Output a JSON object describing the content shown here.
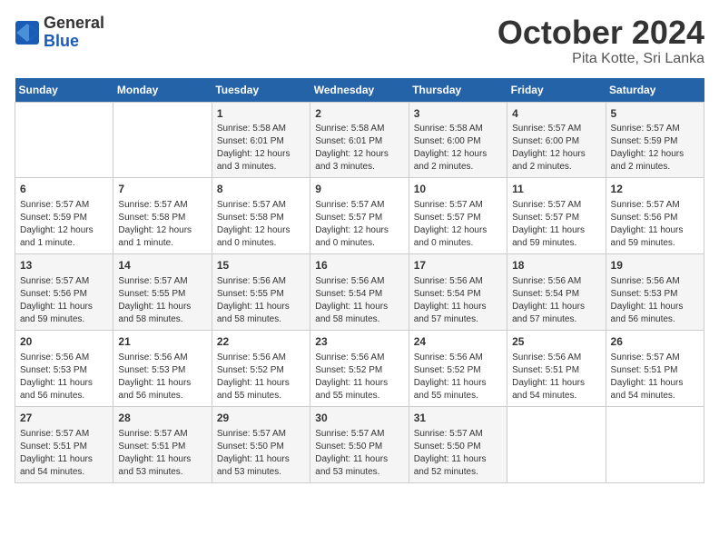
{
  "header": {
    "logo_general": "General",
    "logo_blue": "Blue",
    "month_title": "October 2024",
    "location": "Pita Kotte, Sri Lanka"
  },
  "days_of_week": [
    "Sunday",
    "Monday",
    "Tuesday",
    "Wednesday",
    "Thursday",
    "Friday",
    "Saturday"
  ],
  "weeks": [
    [
      {
        "day": "",
        "info": ""
      },
      {
        "day": "",
        "info": ""
      },
      {
        "day": "1",
        "info": "Sunrise: 5:58 AM\nSunset: 6:01 PM\nDaylight: 12 hours and 3 minutes."
      },
      {
        "day": "2",
        "info": "Sunrise: 5:58 AM\nSunset: 6:01 PM\nDaylight: 12 hours and 3 minutes."
      },
      {
        "day": "3",
        "info": "Sunrise: 5:58 AM\nSunset: 6:00 PM\nDaylight: 12 hours and 2 minutes."
      },
      {
        "day": "4",
        "info": "Sunrise: 5:57 AM\nSunset: 6:00 PM\nDaylight: 12 hours and 2 minutes."
      },
      {
        "day": "5",
        "info": "Sunrise: 5:57 AM\nSunset: 5:59 PM\nDaylight: 12 hours and 2 minutes."
      }
    ],
    [
      {
        "day": "6",
        "info": "Sunrise: 5:57 AM\nSunset: 5:59 PM\nDaylight: 12 hours and 1 minute."
      },
      {
        "day": "7",
        "info": "Sunrise: 5:57 AM\nSunset: 5:58 PM\nDaylight: 12 hours and 1 minute."
      },
      {
        "day": "8",
        "info": "Sunrise: 5:57 AM\nSunset: 5:58 PM\nDaylight: 12 hours and 0 minutes."
      },
      {
        "day": "9",
        "info": "Sunrise: 5:57 AM\nSunset: 5:57 PM\nDaylight: 12 hours and 0 minutes."
      },
      {
        "day": "10",
        "info": "Sunrise: 5:57 AM\nSunset: 5:57 PM\nDaylight: 12 hours and 0 minutes."
      },
      {
        "day": "11",
        "info": "Sunrise: 5:57 AM\nSunset: 5:57 PM\nDaylight: 11 hours and 59 minutes."
      },
      {
        "day": "12",
        "info": "Sunrise: 5:57 AM\nSunset: 5:56 PM\nDaylight: 11 hours and 59 minutes."
      }
    ],
    [
      {
        "day": "13",
        "info": "Sunrise: 5:57 AM\nSunset: 5:56 PM\nDaylight: 11 hours and 59 minutes."
      },
      {
        "day": "14",
        "info": "Sunrise: 5:57 AM\nSunset: 5:55 PM\nDaylight: 11 hours and 58 minutes."
      },
      {
        "day": "15",
        "info": "Sunrise: 5:56 AM\nSunset: 5:55 PM\nDaylight: 11 hours and 58 minutes."
      },
      {
        "day": "16",
        "info": "Sunrise: 5:56 AM\nSunset: 5:54 PM\nDaylight: 11 hours and 58 minutes."
      },
      {
        "day": "17",
        "info": "Sunrise: 5:56 AM\nSunset: 5:54 PM\nDaylight: 11 hours and 57 minutes."
      },
      {
        "day": "18",
        "info": "Sunrise: 5:56 AM\nSunset: 5:54 PM\nDaylight: 11 hours and 57 minutes."
      },
      {
        "day": "19",
        "info": "Sunrise: 5:56 AM\nSunset: 5:53 PM\nDaylight: 11 hours and 56 minutes."
      }
    ],
    [
      {
        "day": "20",
        "info": "Sunrise: 5:56 AM\nSunset: 5:53 PM\nDaylight: 11 hours and 56 minutes."
      },
      {
        "day": "21",
        "info": "Sunrise: 5:56 AM\nSunset: 5:53 PM\nDaylight: 11 hours and 56 minutes."
      },
      {
        "day": "22",
        "info": "Sunrise: 5:56 AM\nSunset: 5:52 PM\nDaylight: 11 hours and 55 minutes."
      },
      {
        "day": "23",
        "info": "Sunrise: 5:56 AM\nSunset: 5:52 PM\nDaylight: 11 hours and 55 minutes."
      },
      {
        "day": "24",
        "info": "Sunrise: 5:56 AM\nSunset: 5:52 PM\nDaylight: 11 hours and 55 minutes."
      },
      {
        "day": "25",
        "info": "Sunrise: 5:56 AM\nSunset: 5:51 PM\nDaylight: 11 hours and 54 minutes."
      },
      {
        "day": "26",
        "info": "Sunrise: 5:57 AM\nSunset: 5:51 PM\nDaylight: 11 hours and 54 minutes."
      }
    ],
    [
      {
        "day": "27",
        "info": "Sunrise: 5:57 AM\nSunset: 5:51 PM\nDaylight: 11 hours and 54 minutes."
      },
      {
        "day": "28",
        "info": "Sunrise: 5:57 AM\nSunset: 5:51 PM\nDaylight: 11 hours and 53 minutes."
      },
      {
        "day": "29",
        "info": "Sunrise: 5:57 AM\nSunset: 5:50 PM\nDaylight: 11 hours and 53 minutes."
      },
      {
        "day": "30",
        "info": "Sunrise: 5:57 AM\nSunset: 5:50 PM\nDaylight: 11 hours and 53 minutes."
      },
      {
        "day": "31",
        "info": "Sunrise: 5:57 AM\nSunset: 5:50 PM\nDaylight: 11 hours and 52 minutes."
      },
      {
        "day": "",
        "info": ""
      },
      {
        "day": "",
        "info": ""
      }
    ]
  ]
}
